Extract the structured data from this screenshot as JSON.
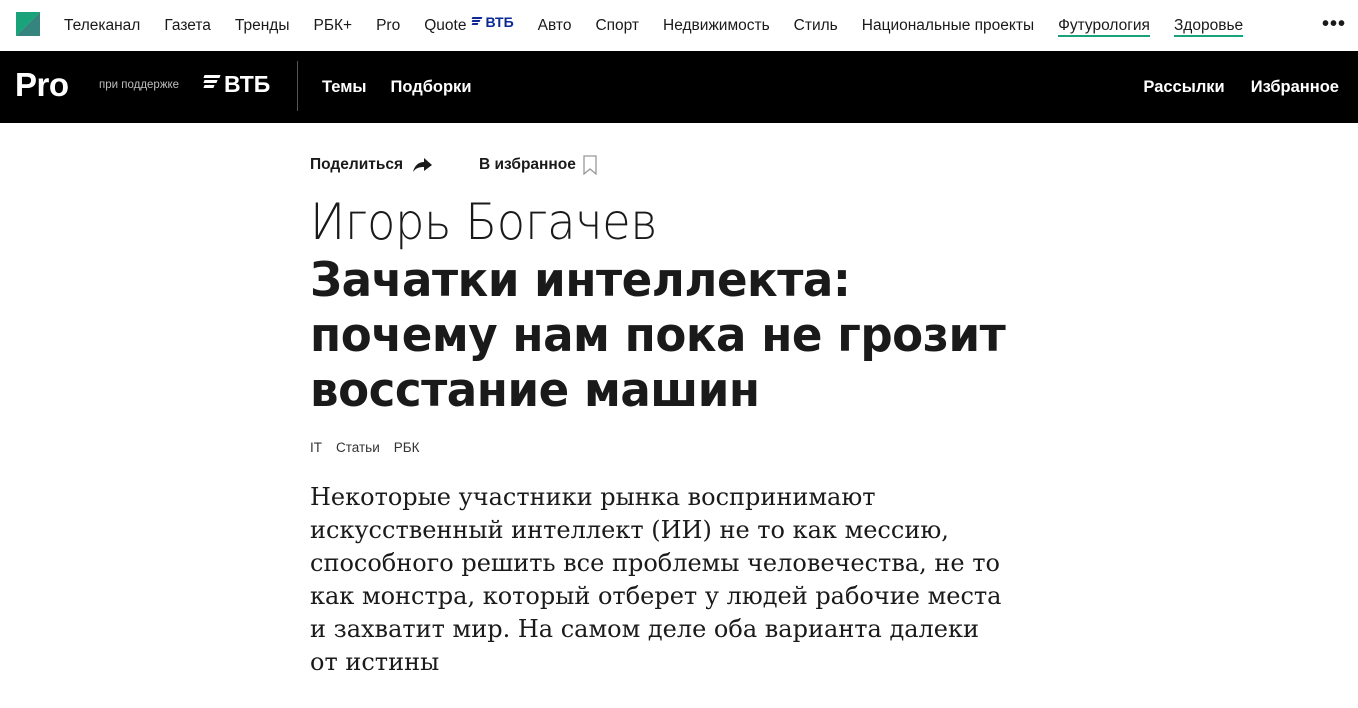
{
  "colors": {
    "accent": "#1aa37a",
    "vtb_blue": "#0a2896",
    "black_bar": "#000000"
  },
  "top_nav": {
    "items": [
      {
        "label": "Телеканал",
        "underlined": false
      },
      {
        "label": "Газета",
        "underlined": false
      },
      {
        "label": "Тренды",
        "underlined": false
      },
      {
        "label": "РБК+",
        "underlined": false
      },
      {
        "label": "Pro",
        "underlined": false
      },
      {
        "label": "Quote",
        "underlined": false,
        "partner": "ВТБ"
      },
      {
        "label": "Авто",
        "underlined": false
      },
      {
        "label": "Спорт",
        "underlined": false
      },
      {
        "label": "Недвижимость",
        "underlined": false
      },
      {
        "label": "Стиль",
        "underlined": false
      },
      {
        "label": "Национальные проекты",
        "underlined": false
      },
      {
        "label": "Футурология",
        "underlined": true
      },
      {
        "label": "Здоровье",
        "underlined": true
      }
    ],
    "more_icon": "more-horizontal-icon"
  },
  "pro_bar": {
    "logo": "Pro",
    "support_text": "при поддержке",
    "partner": "ВТБ",
    "left_links": [
      "Темы",
      "Подборки"
    ],
    "right_links": [
      "Рассылки",
      "Избранное"
    ]
  },
  "article": {
    "share_label": "Поделиться",
    "favorite_label": "В избранное",
    "author": "Игорь Богачев",
    "headline": "Зачатки интеллекта: почему нам пока не грозит восстание машин",
    "tags": [
      "IT",
      "Статьи",
      "РБК"
    ],
    "lead": "Некоторые участники рынка воспринимают искусственный интеллект (ИИ) не то как мессию, способного решить все проблемы человечества, не то как монстра, который отберет у людей рабочие места и захватит мир. На самом деле оба варианта далеки от истины"
  }
}
